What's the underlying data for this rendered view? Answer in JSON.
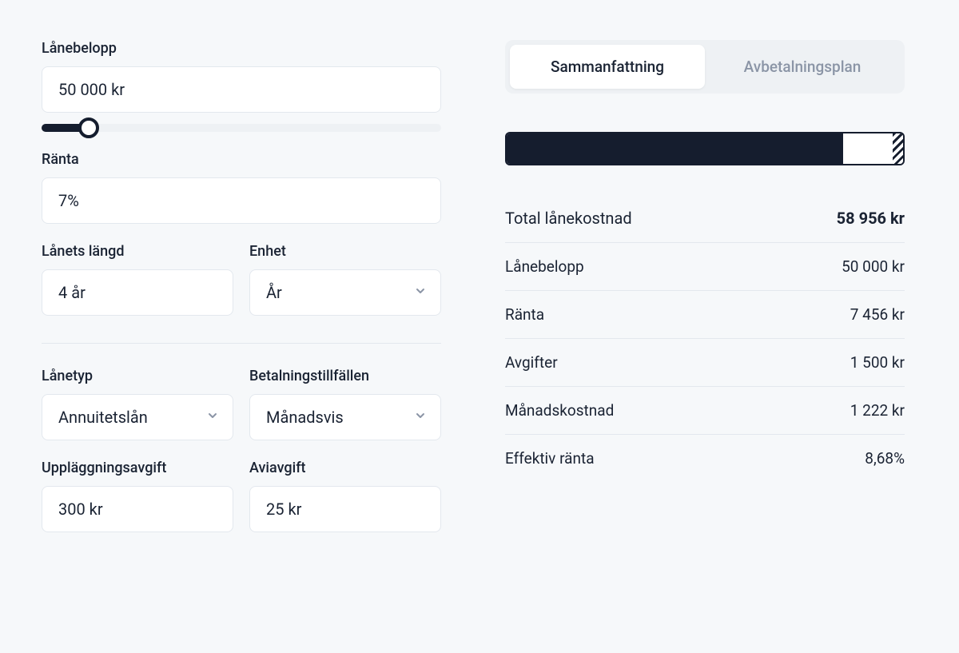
{
  "form": {
    "amount": {
      "label": "Lånebelopp",
      "value": "50 000 kr",
      "slider_percent": 10
    },
    "interest": {
      "label": "Ränta",
      "value": "7%"
    },
    "length": {
      "label": "Lånets längd",
      "value": "4 år"
    },
    "unit": {
      "label": "Enhet",
      "value": "År"
    },
    "loan_type": {
      "label": "Lånetyp",
      "value": "Annuitetslån"
    },
    "pay_freq": {
      "label": "Betalningstillfällen",
      "value": "Månadsvis"
    },
    "setup_fee": {
      "label": "Uppläggningsavgift",
      "value": "300 kr"
    },
    "notice_fee": {
      "label": "Aviavgift",
      "value": "25 kr"
    }
  },
  "tabs": {
    "summary": "Sammanfattning",
    "schedule": "Avbetalningsplan"
  },
  "bar": {
    "principal_pct": 84.8,
    "interest_pct": 12.6,
    "fees_pct": 2.6
  },
  "summary": {
    "total": {
      "label": "Total lånekostnad",
      "value": "58 956 kr"
    },
    "amount": {
      "label": "Lånebelopp",
      "value": "50 000 kr"
    },
    "interest": {
      "label": "Ränta",
      "value": "7 456 kr"
    },
    "fees": {
      "label": "Avgifter",
      "value": "1 500 kr"
    },
    "monthly": {
      "label": "Månadskostnad",
      "value": "1 222 kr"
    },
    "apr": {
      "label": "Effektiv ränta",
      "value": "8,68%"
    }
  }
}
